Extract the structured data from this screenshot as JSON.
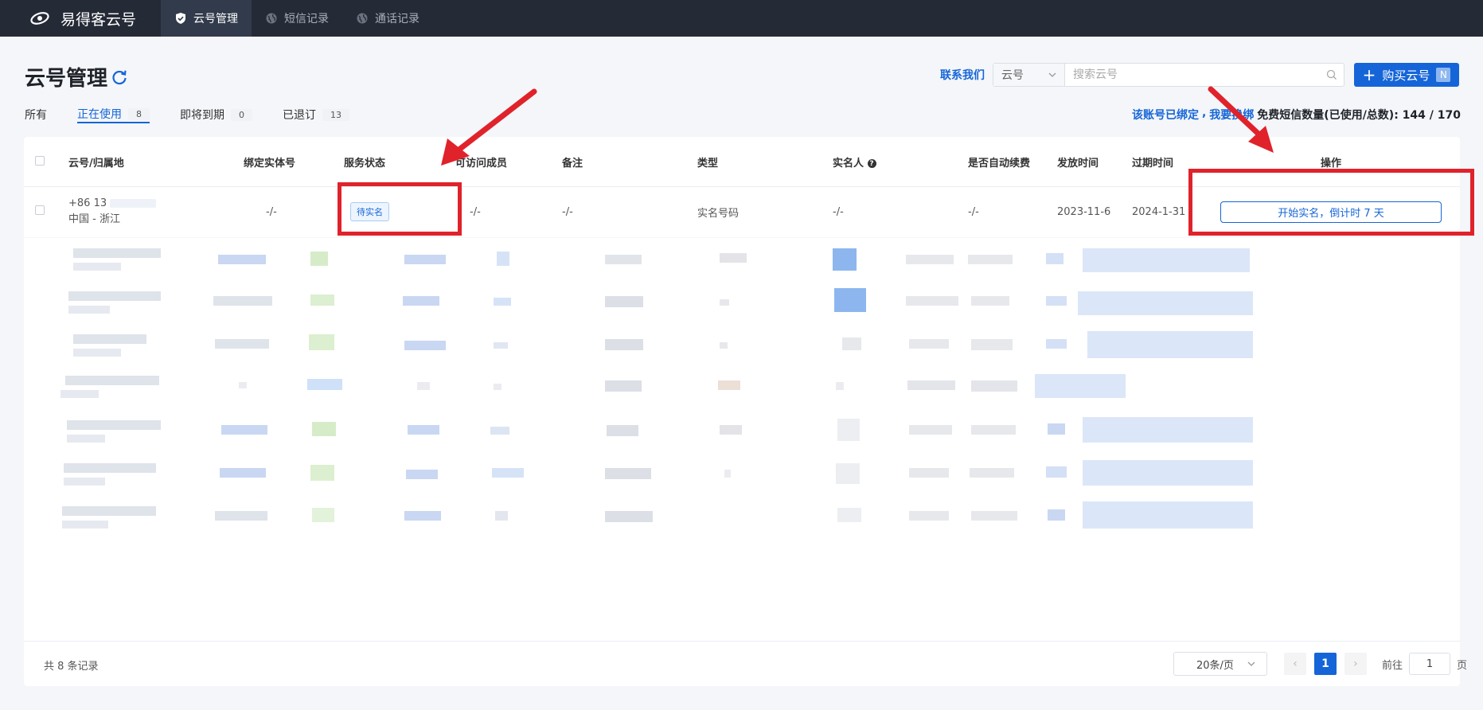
{
  "topbar": {
    "brand": "易得客云号",
    "nav": [
      {
        "label": "云号管理",
        "icon": "shield-check-icon",
        "active": true
      },
      {
        "label": "短信记录",
        "icon": "globe-icon",
        "active": false
      },
      {
        "label": "通话记录",
        "icon": "globe-icon",
        "active": false
      }
    ]
  },
  "page": {
    "title": "云号管理",
    "contact_link": "联系我们",
    "search_select": "云号",
    "search_placeholder": "搜索云号",
    "buy_button": "购买云号",
    "buy_badge": "N"
  },
  "tabs": [
    {
      "label": "所有",
      "count": ""
    },
    {
      "label": "正在使用",
      "count": "8"
    },
    {
      "label": "即将到期",
      "count": "0"
    },
    {
      "label": "已退订",
      "count": "13"
    }
  ],
  "quota": {
    "bound_link": "该账号已绑定",
    "separator": ",",
    "change_link": "我要换绑",
    "text": "免费短信数量(已使用/总数): 144 / 170"
  },
  "table": {
    "headers": [
      "云号/归属地",
      "绑定实体号",
      "服务状态",
      "可访问成员",
      "备注",
      "类型",
      "实名人",
      "是否自动续费",
      "发放时间",
      "过期时间",
      "操作"
    ],
    "first_row": {
      "number": "+86 13",
      "location": "中国 - 浙江",
      "entity": "-/-",
      "status": "待实名",
      "members": "-/-",
      "note": "-/-",
      "type": "实名号码",
      "realname": "-/-",
      "autorenew": "-/-",
      "issued": "2023-11-6",
      "expires": "2024-1-31",
      "action": "开始实名，倒计时 7 天"
    }
  },
  "footer": {
    "total": "共 8 条记录",
    "page_size": "20条/页",
    "current_page": "1",
    "goto_label": "前往",
    "goto_value": "1",
    "goto_suffix": "页"
  },
  "colors": {
    "accent": "#1565d8",
    "topbar": "#242a36",
    "annotation": "#e0222b"
  }
}
